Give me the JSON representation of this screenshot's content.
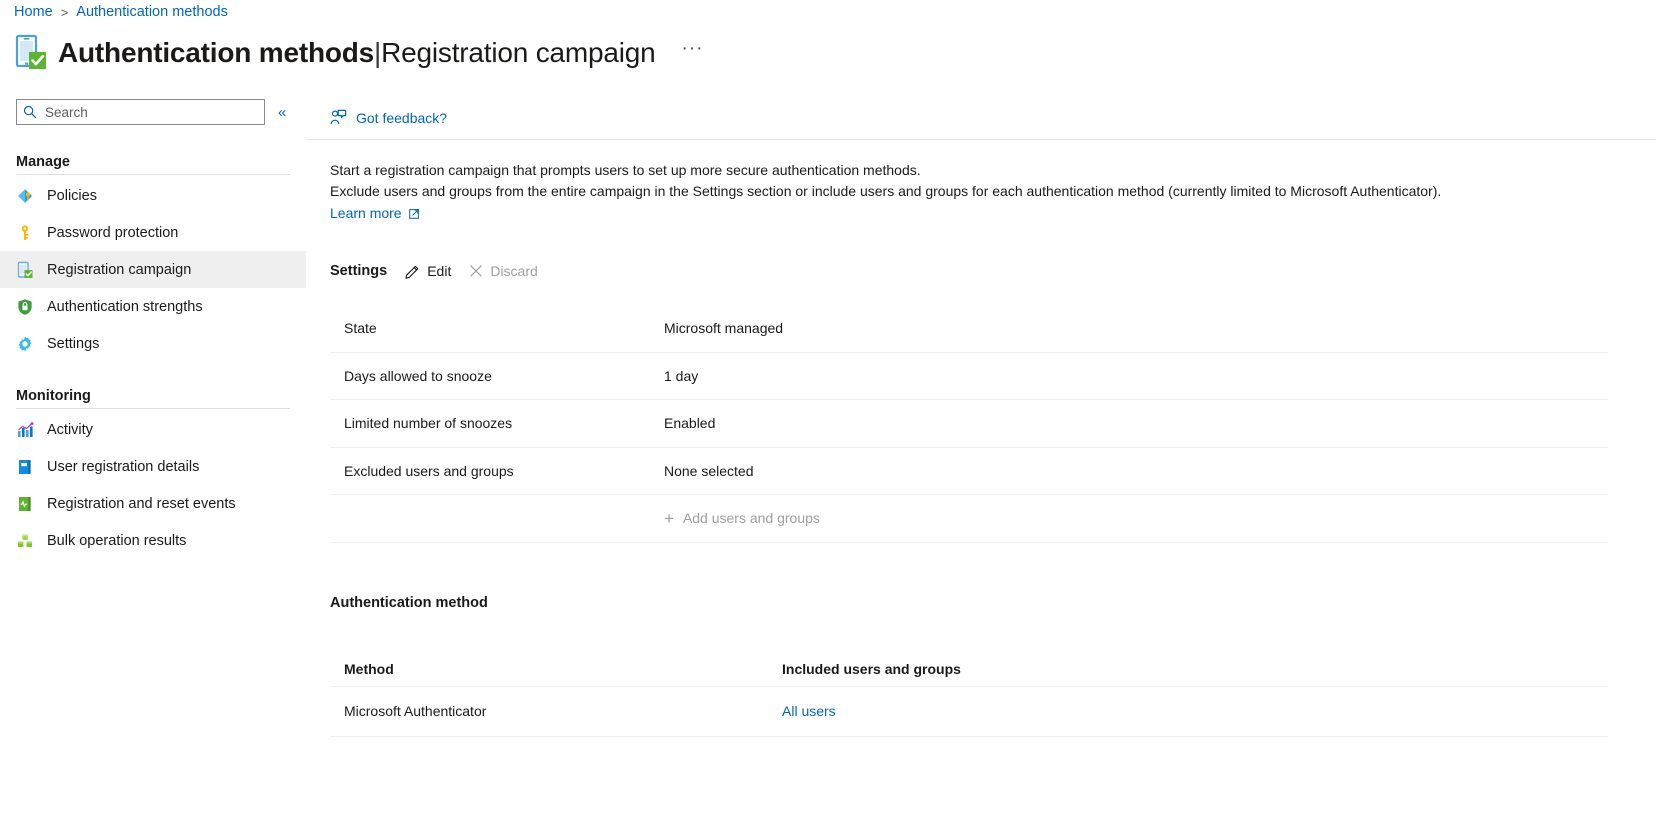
{
  "breadcrumb": {
    "home": "Home",
    "separator": ">",
    "current": "Authentication methods"
  },
  "header": {
    "title_main": "Authentication methods",
    "title_separator": "|",
    "title_sub": "Registration campaign",
    "more_label": "···",
    "icon": "mobile-check-icon"
  },
  "sidebar": {
    "search": {
      "placeholder": "Search",
      "value": "",
      "icon": "search-icon"
    },
    "collapse_label": "«",
    "groups": [
      {
        "title": "Manage",
        "items": [
          {
            "label": "Policies",
            "icon": "policies-icon",
            "selected": false
          },
          {
            "label": "Password protection",
            "icon": "key-icon",
            "selected": false
          },
          {
            "label": "Registration campaign",
            "icon": "mobile-check-icon",
            "selected": true
          },
          {
            "label": "Authentication strengths",
            "icon": "shield-lock-icon",
            "selected": false
          },
          {
            "label": "Settings",
            "icon": "gear-icon",
            "selected": false
          }
        ]
      },
      {
        "title": "Monitoring",
        "items": [
          {
            "label": "Activity",
            "icon": "bar-chart-icon",
            "selected": false
          },
          {
            "label": "User registration details",
            "icon": "blue-book-icon",
            "selected": false
          },
          {
            "label": "Registration and reset events",
            "icon": "green-book-icon",
            "selected": false
          },
          {
            "label": "Bulk operation results",
            "icon": "bulk-blocks-icon",
            "selected": false
          }
        ]
      }
    ]
  },
  "command_bar": {
    "feedback_label": "Got feedback?",
    "feedback_icon": "feedback-person-icon"
  },
  "main": {
    "description_line1": "Start a registration campaign that prompts users to set up more secure authentication methods.",
    "description_line2": "Exclude users and groups from the entire campaign in the Settings section or include users and groups for each authentication method (currently limited to Microsoft Authenticator).",
    "learn_more_label": "Learn more",
    "learn_more_icon": "external-link-icon",
    "settings": {
      "title": "Settings",
      "edit_label": "Edit",
      "edit_icon": "pencil-icon",
      "discard_label": "Discard",
      "discard_icon": "close-x-icon",
      "rows": [
        {
          "key": "State",
          "value": "Microsoft managed"
        },
        {
          "key": "Days allowed to snooze",
          "value": "1 day"
        },
        {
          "key": "Limited number of snoozes",
          "value": "Enabled"
        },
        {
          "key": "Excluded users and groups",
          "value": "None selected"
        }
      ],
      "add_label": "Add users and groups",
      "add_icon": "plus-icon"
    },
    "auth_method": {
      "title": "Authentication method",
      "columns": [
        "Method",
        "Included users and groups"
      ],
      "rows": [
        {
          "method": "Microsoft Authenticator",
          "included": "All users"
        }
      ]
    }
  },
  "colors": {
    "link": "#0067b8",
    "selected_row": "#efefef",
    "border": "#f0f0f0",
    "text": "#1b1a19",
    "disabled": "#a19f9d"
  }
}
